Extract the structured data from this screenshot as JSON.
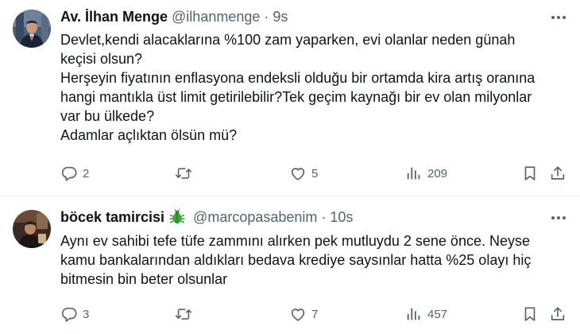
{
  "tweets": [
    {
      "display_name": "Av. İlhan Menge",
      "handle": "@ilhanmenge",
      "separator": "·",
      "time": "9s",
      "avatar_icon": "person-in-suit-avatar",
      "badge_icon": "",
      "text_lines": [
        "Devlet,kendi alacaklarına %100 zam yaparken, evi olanlar neden günah",
        "keçisi olsun?",
        "Herşeyin fiyatının enflasyona endeksli olduğu bir ortamda kira artış oranına",
        "hangi mantıkla üst limit getirilebilir?Tek geçim kaynağı bir ev olan milyonlar",
        "var bu ülkede?",
        "Adamlar açlıktan ölsün mü?"
      ],
      "replies": "2",
      "retweets": "",
      "likes": "5",
      "views": "209"
    },
    {
      "display_name": "böcek tamircisi",
      "handle": "@marcopasabenim",
      "separator": "·",
      "time": "10s",
      "avatar_icon": "person-photo-avatar",
      "badge_icon": "bug-emoji-icon",
      "text_lines": [
        "Aynı ev sahibi tefe tüfe zammını alırken pek mutluydu 2 sene önce. Neyse",
        "kamu bankalarından aldıkları bedava krediye saysınlar hatta %25 olayı hiç",
        "bitmesin bin beter olsunlar"
      ],
      "replies": "3",
      "retweets": "",
      "likes": "7",
      "views": "457"
    }
  ],
  "colors": {
    "text_primary": "#0f1419",
    "text_secondary": "#536471",
    "divider": "#e6ecf0",
    "bug_green": "#3aa63a"
  }
}
